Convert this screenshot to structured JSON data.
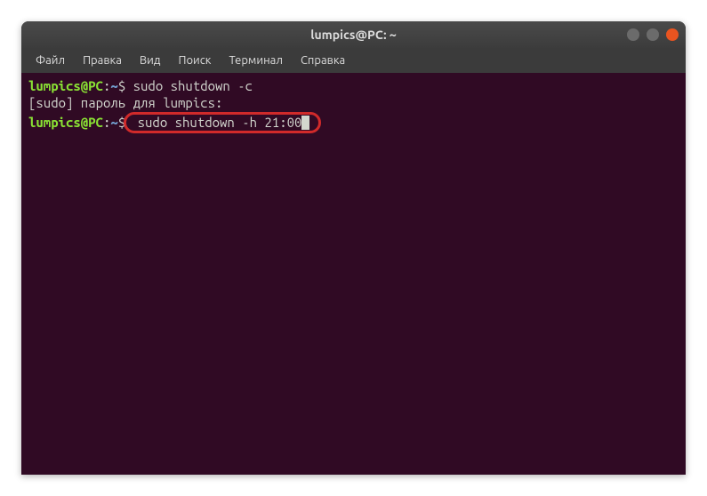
{
  "window": {
    "title": "lumpics@PC: ~"
  },
  "menubar": {
    "items": [
      {
        "label": "Файл"
      },
      {
        "label": "Правка"
      },
      {
        "label": "Вид"
      },
      {
        "label": "Поиск"
      },
      {
        "label": "Терминал"
      },
      {
        "label": "Справка"
      }
    ]
  },
  "terminal": {
    "prompt_user": "lumpics@PC",
    "prompt_sep": ":",
    "prompt_path": "~",
    "prompt_dollar": "$",
    "lines": {
      "line1_cmd": " sudo shutdown -c",
      "line2_text": "[sudo] пароль для lumpics:",
      "line3_cmd": " sudo shutdown -h 21:00"
    }
  }
}
